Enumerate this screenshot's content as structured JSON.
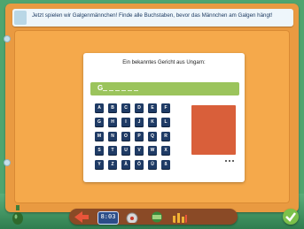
{
  "banner": {
    "instruction": "Jetzt spielen wir Galgenmännchen! Finde alle Buchstaben, bevor das Männchen am Galgen hängt!"
  },
  "game": {
    "prompt": "Ein bekanntes Gericht aus Ungarn:",
    "revealed_letter": "G",
    "hidden_slot_count": 6,
    "keys": [
      "A",
      "B",
      "C",
      "D",
      "E",
      "F",
      "G",
      "H",
      "I",
      "J",
      "K",
      "L",
      "M",
      "N",
      "O",
      "P",
      "Q",
      "R",
      "S",
      "T",
      "U",
      "V",
      "W",
      "X",
      "Y",
      "Z",
      "Ä",
      "Ö",
      "Ü",
      "ß"
    ],
    "more_indicator": "..."
  },
  "toolbar": {
    "clock_text": "8:03"
  },
  "colors": {
    "paper": "#e99a41",
    "word_bar": "#9bc45c",
    "key": "#1f3b65",
    "gallows": "#d95f3a"
  }
}
